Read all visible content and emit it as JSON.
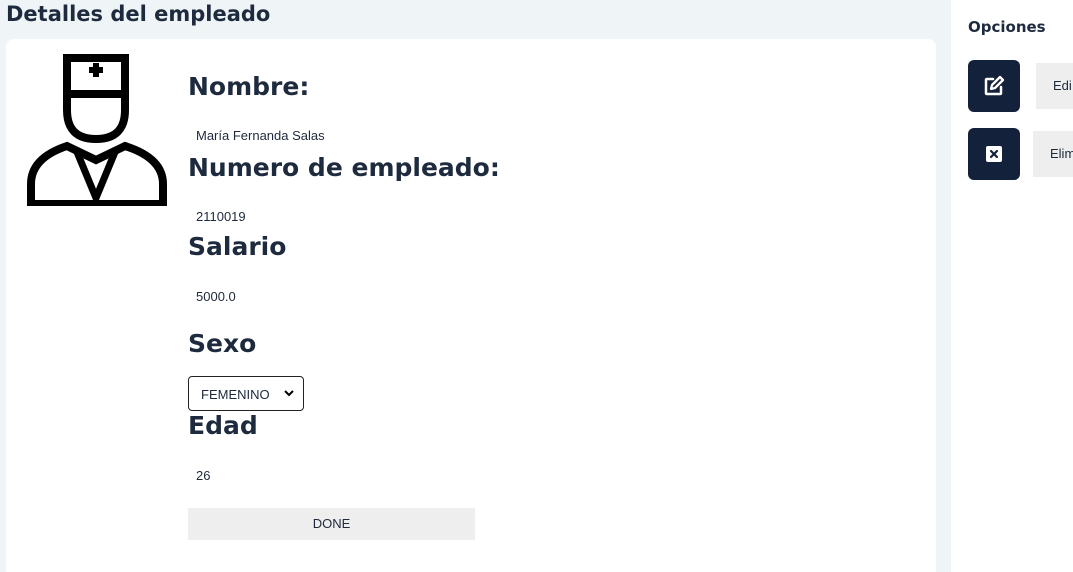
{
  "page": {
    "title": "Detalles del empleado"
  },
  "employee": {
    "fields": {
      "name_label": "Nombre:",
      "name_value": "María Fernanda Salas",
      "number_label": "Numero de empleado:",
      "number_value": "2110019",
      "salary_label": "Salario",
      "salary_value": "5000.0",
      "sex_label": "Sexo",
      "sex_value": "FEMENINO",
      "age_label": "Edad",
      "age_value": "26"
    },
    "done_label": "DONE",
    "avatar_icon": "doctor-icon"
  },
  "sidebar": {
    "title": "Opciones",
    "actions": [
      {
        "icon": "edit-icon",
        "label": "Edi"
      },
      {
        "icon": "close-box-icon",
        "label": "Elim"
      }
    ]
  },
  "colors": {
    "background": "#eff4f7",
    "card": "#ffffff",
    "heading": "#1e2a3d",
    "icon_button": "#14213a",
    "button_gray": "#eeeeee"
  }
}
